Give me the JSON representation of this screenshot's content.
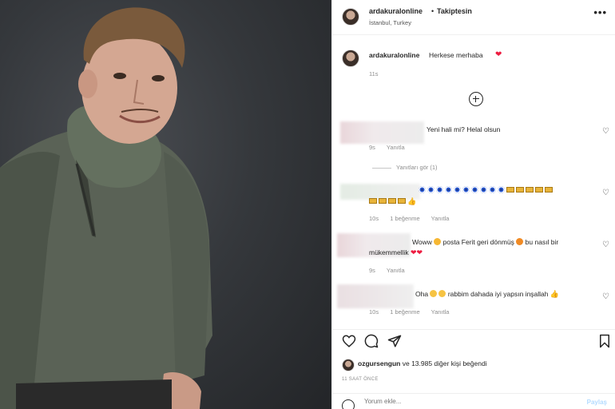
{
  "header": {
    "username": "ardakuralonline",
    "dot": "•",
    "follow_status": "Takiptesin",
    "location": "İstanbul, Turkey",
    "more": "•••"
  },
  "caption": {
    "username": "ardakuralonline",
    "text": "Herkese merhaba",
    "time": "11s"
  },
  "comments": [
    {
      "text": "Yeni hali mi? Helal olsun",
      "time": "9s",
      "reply": "Yanıtla"
    },
    {
      "time": "10s",
      "likes": "1 beğenme",
      "reply": "Yanıtla"
    },
    {
      "text_1": "Woww",
      "text_2": "posta Ferit geri dönmüş",
      "text_3": "bu nasıl bir",
      "text_4": "mükemmellik",
      "time": "9s",
      "reply": "Yanıtla"
    },
    {
      "text_1": "Oha",
      "text_2": "rabbim dahada iyi yapsın inşallah",
      "time": "10s",
      "likes": "1 beğenme",
      "reply": "Yanıtla"
    }
  ],
  "view_replies": "Yanıtları gör (1)",
  "likes": {
    "user": "ozgursengun",
    "rest": "ve 13.985 diğer kişi beğendi"
  },
  "posted": "11 SAAT ÖNCE",
  "add_comment": {
    "placeholder": "Yorum ekle...",
    "share": "Paylaş"
  },
  "colors": {
    "heart": "#ed1c40",
    "meta": "#8e8e8e",
    "text": "#262626"
  }
}
